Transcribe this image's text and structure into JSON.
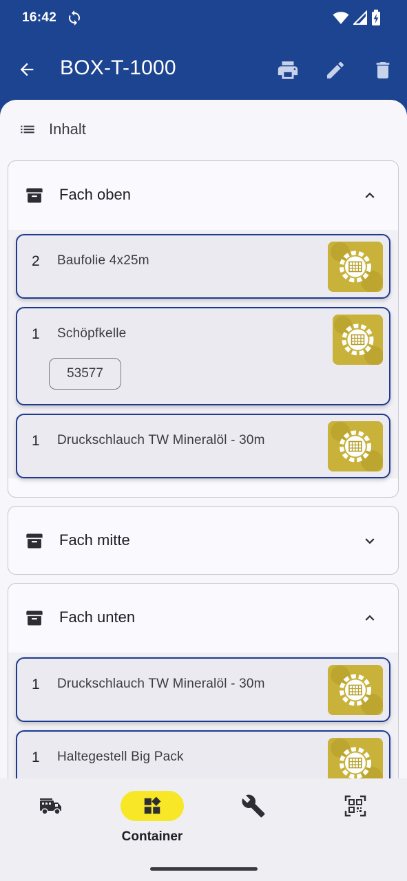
{
  "status_bar": {
    "time": "16:42"
  },
  "app_bar": {
    "title": "BOX-T-1000",
    "icons": [
      "back-arrow-icon",
      "print-icon",
      "edit-icon",
      "delete-icon"
    ]
  },
  "content": {
    "header_label": "Inhalt"
  },
  "sections": [
    {
      "title": "Fach oben",
      "expanded": true,
      "items": [
        {
          "qty": "2",
          "name": "Baufolie 4x25m"
        },
        {
          "qty": "1",
          "name": "Schöpfkelle",
          "tag": "53577"
        },
        {
          "qty": "1",
          "name": "Druckschlauch TW Mineralöl - 30m"
        }
      ]
    },
    {
      "title": "Fach mitte",
      "expanded": false,
      "items": []
    },
    {
      "title": "Fach unten",
      "expanded": true,
      "items": [
        {
          "qty": "1",
          "name": "Druckschlauch TW Mineralöl - 30m"
        },
        {
          "qty": "1",
          "name": "Haltegestell Big Pack"
        }
      ]
    }
  ],
  "bottom_nav": {
    "items": [
      {
        "icon": "fire-truck-icon",
        "active": false
      },
      {
        "icon": "container-icon",
        "label": "Container",
        "active": true
      },
      {
        "icon": "wrench-icon",
        "active": false
      },
      {
        "icon": "qr-code-icon",
        "active": false
      }
    ]
  },
  "colors": {
    "app_bar": "#1d4490",
    "card_border": "#1d3a8f",
    "active_nav": "#f7e727",
    "thumbnail": "#c9b438"
  }
}
